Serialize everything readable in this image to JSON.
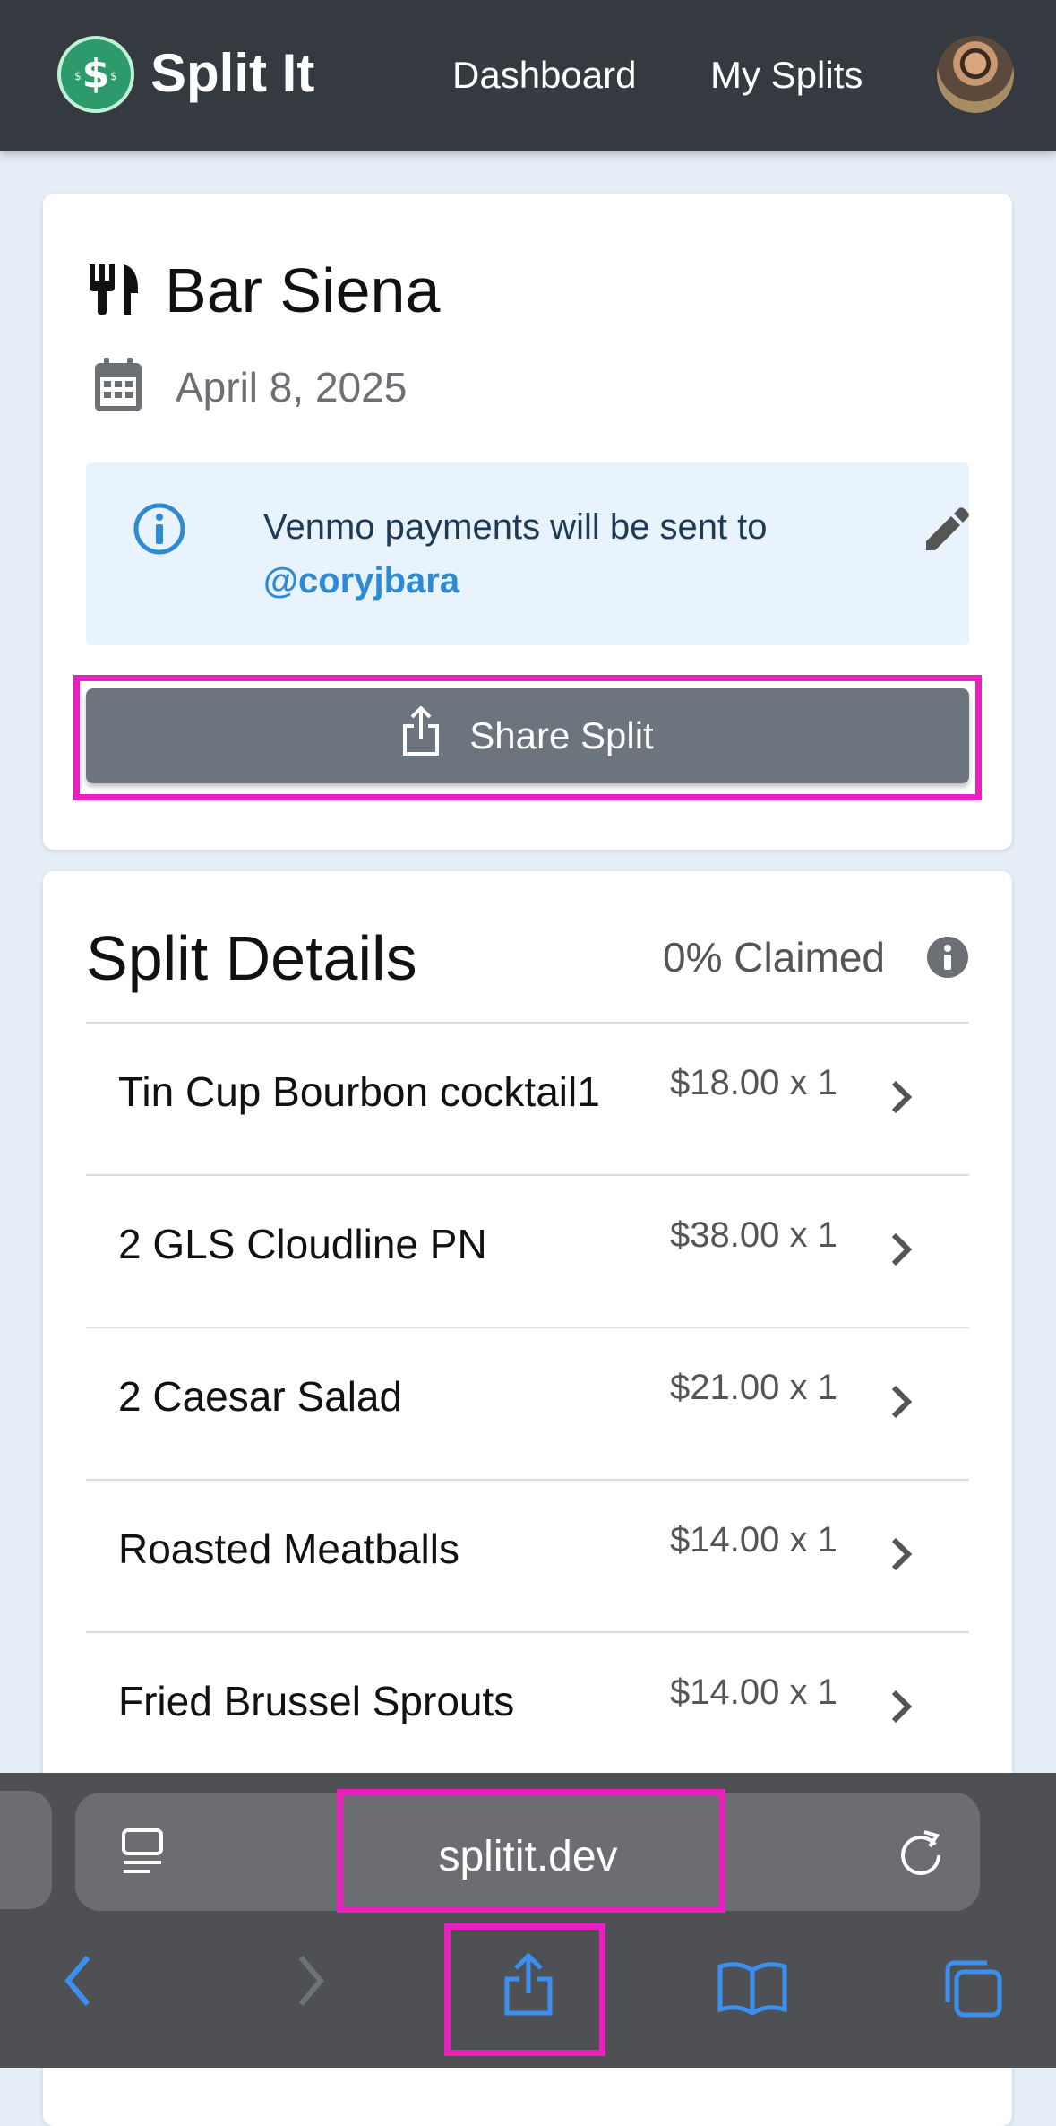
{
  "app": {
    "name": "Split It"
  },
  "nav": {
    "dashboard": "Dashboard",
    "my_splits": "My Splits"
  },
  "split": {
    "restaurant": "Bar Siena",
    "date": "April 8, 2025",
    "venmo_text": "Venmo payments will be sent to",
    "venmo_handle": "@coryjbara",
    "share_label": "Share Split"
  },
  "details": {
    "title": "Split Details",
    "claimed": "0% Claimed",
    "items": [
      {
        "name": "Tin Cup Bourbon cocktail1",
        "price": "$18.00 x 1"
      },
      {
        "name": "2 GLS Cloudline PN",
        "price": "$38.00 x 1"
      },
      {
        "name": "2 Caesar Salad",
        "price": "$21.00 x 1"
      },
      {
        "name": "Roasted Meatballs",
        "price": "$14.00 x 1"
      },
      {
        "name": "Fried Brussel Sprouts",
        "price": "$14.00 x 1"
      }
    ]
  },
  "browser": {
    "url": "splitit.dev"
  },
  "colors": {
    "navbar": "#343a40",
    "accent_link": "#2d8bd6",
    "button": "#6c757d",
    "highlight": "#ea1fbf",
    "safari_blue": "#3b8ff0"
  }
}
